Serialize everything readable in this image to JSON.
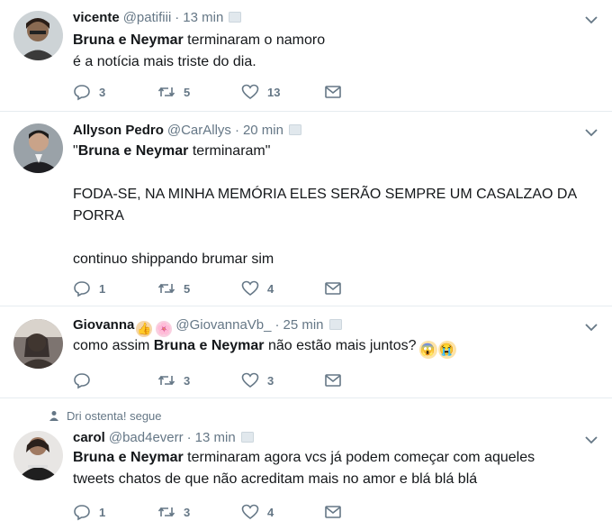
{
  "tweets": [
    {
      "name": "vicente",
      "handle": "@patifiii",
      "time": "13 min",
      "lines": [
        [
          {
            "t": "Bruna e Neymar",
            "b": true
          },
          {
            "t": " terminaram o namoro",
            "b": false
          }
        ],
        [
          {
            "t": "é a notícia mais triste do dia.",
            "b": false
          }
        ]
      ],
      "replies": "3",
      "retweets": "5",
      "likes": "13"
    },
    {
      "name": "Allyson Pedro",
      "handle": "@CarAllys",
      "time": "20 min",
      "lines": [
        [
          {
            "t": "\"",
            "b": false
          },
          {
            "t": "Bruna e Neymar",
            "b": true
          },
          {
            "t": " terminaram\"",
            "b": false
          }
        ],
        [
          {
            "t": "",
            "b": false
          }
        ],
        [
          {
            "t": "FODA-SE, NA MINHA MEMÓRIA ELES SERÃO SEMPRE UM CASALZAO DA",
            "b": false
          }
        ],
        [
          {
            "t": "PORRA",
            "b": false
          }
        ],
        [
          {
            "t": "",
            "b": false
          }
        ],
        [
          {
            "t": "continuo shippando brumar sim",
            "b": false
          }
        ]
      ],
      "replies": "1",
      "retweets": "5",
      "likes": "4"
    },
    {
      "name": "Giovanna",
      "handle": "@GiovannaVb_",
      "time": "25 min",
      "name_emojis": [
        "👍",
        "🌸"
      ],
      "lines": [
        [
          {
            "t": "como assim ",
            "b": false
          },
          {
            "t": "Bruna e Neymar",
            "b": true
          },
          {
            "t": " não estão mais juntos?",
            "b": false
          }
        ]
      ],
      "text_emojis": [
        "😱",
        "😭"
      ],
      "replies": "",
      "retweets": "3",
      "likes": "3"
    },
    {
      "social_context": "Dri ostenta! segue",
      "name": "carol",
      "handle": "@bad4everr",
      "time": "13 min",
      "lines": [
        [
          {
            "t": "Bruna e Neymar",
            "b": true
          },
          {
            "t": " terminaram agora vcs já podem começar com aqueles",
            "b": false
          }
        ],
        [
          {
            "t": "tweets chatos de que não acreditam mais no amor e blá blá blá",
            "b": false
          }
        ]
      ],
      "replies": "1",
      "retweets": "3",
      "likes": "4"
    }
  ],
  "colors": {
    "text": "#14171a",
    "muted": "#657786",
    "divider": "#e6ecf0"
  }
}
